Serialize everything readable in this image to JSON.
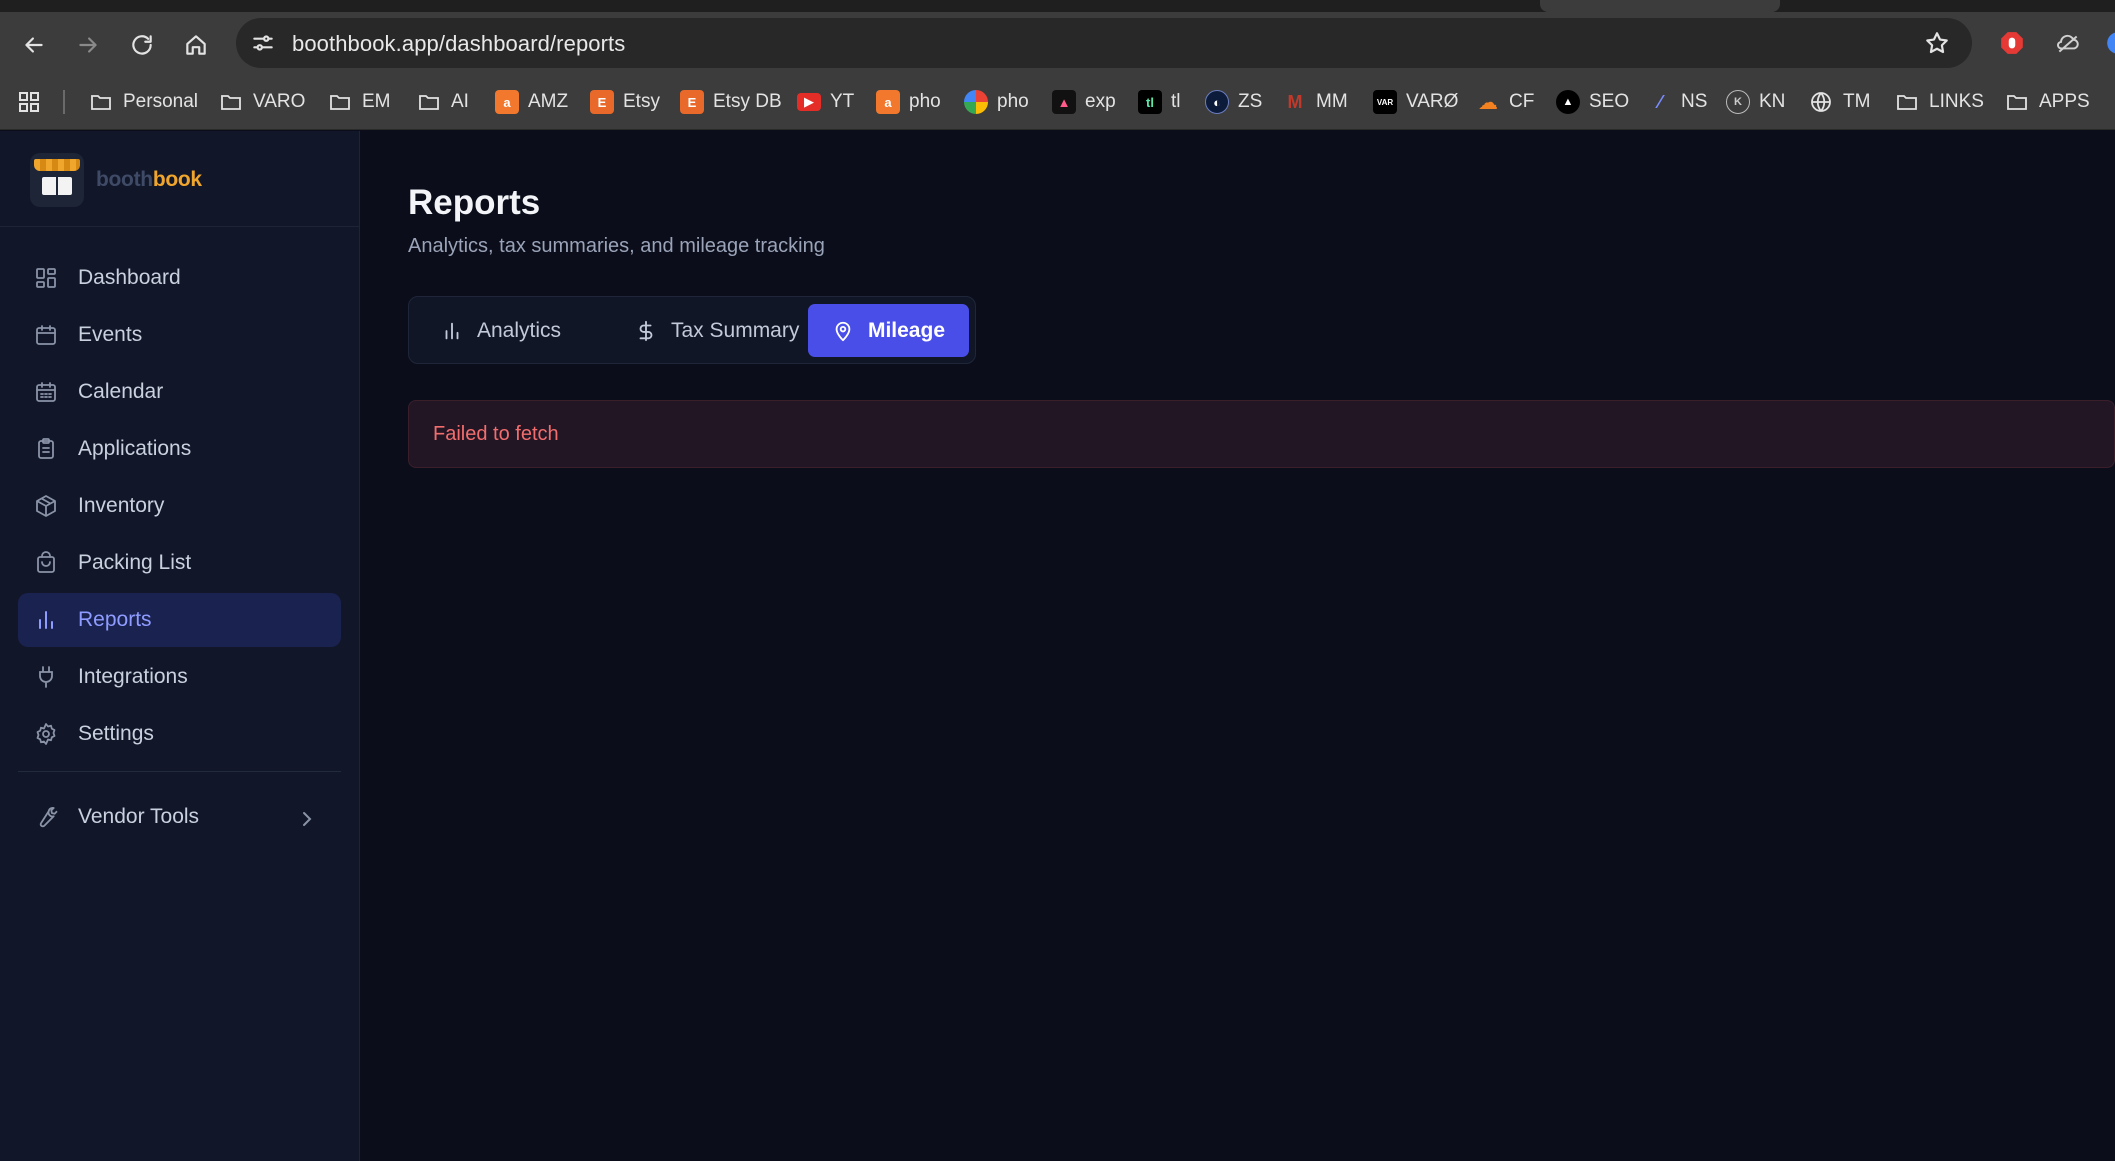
{
  "browser": {
    "url": "boothbook.app/dashboard/reports",
    "bookmarks": [
      "Personal",
      "VARO",
      "EM",
      "AI",
      "AMZ",
      "Etsy",
      "Etsy DB",
      "YT",
      "pho",
      "pho",
      "exp",
      "tl",
      "ZS",
      "MM",
      "VARØ",
      "CF",
      "SEO",
      "NS",
      "KN",
      "TM",
      "LINKS",
      "APPS"
    ]
  },
  "brand": {
    "part1": "booth",
    "part2": "book"
  },
  "sidebar": {
    "items": [
      {
        "label": "Dashboard",
        "icon": "dashboard-icon"
      },
      {
        "label": "Events",
        "icon": "calendar-icon"
      },
      {
        "label": "Calendar",
        "icon": "calendar-grid-icon"
      },
      {
        "label": "Applications",
        "icon": "clipboard-icon"
      },
      {
        "label": "Inventory",
        "icon": "package-icon"
      },
      {
        "label": "Packing List",
        "icon": "bag-icon"
      },
      {
        "label": "Reports",
        "icon": "bar-chart-icon",
        "active": true
      },
      {
        "label": "Integrations",
        "icon": "plug-icon"
      },
      {
        "label": "Settings",
        "icon": "gear-icon"
      }
    ],
    "vendor_tools": "Vendor Tools"
  },
  "page": {
    "title": "Reports",
    "subtitle": "Analytics, tax summaries, and mileage tracking",
    "tabs": [
      {
        "label": "Analytics",
        "icon": "bar-chart-icon"
      },
      {
        "label": "Tax Summary",
        "icon": "dollar-icon"
      },
      {
        "label": "Mileage",
        "icon": "map-pin-icon",
        "active": true
      }
    ],
    "error": "Failed to fetch"
  },
  "colors": {
    "accent": "#4a4ee8",
    "active_nav_bg": "#1a2250",
    "brand_orange": "#f0a52c",
    "error_text": "#f26d6d"
  }
}
